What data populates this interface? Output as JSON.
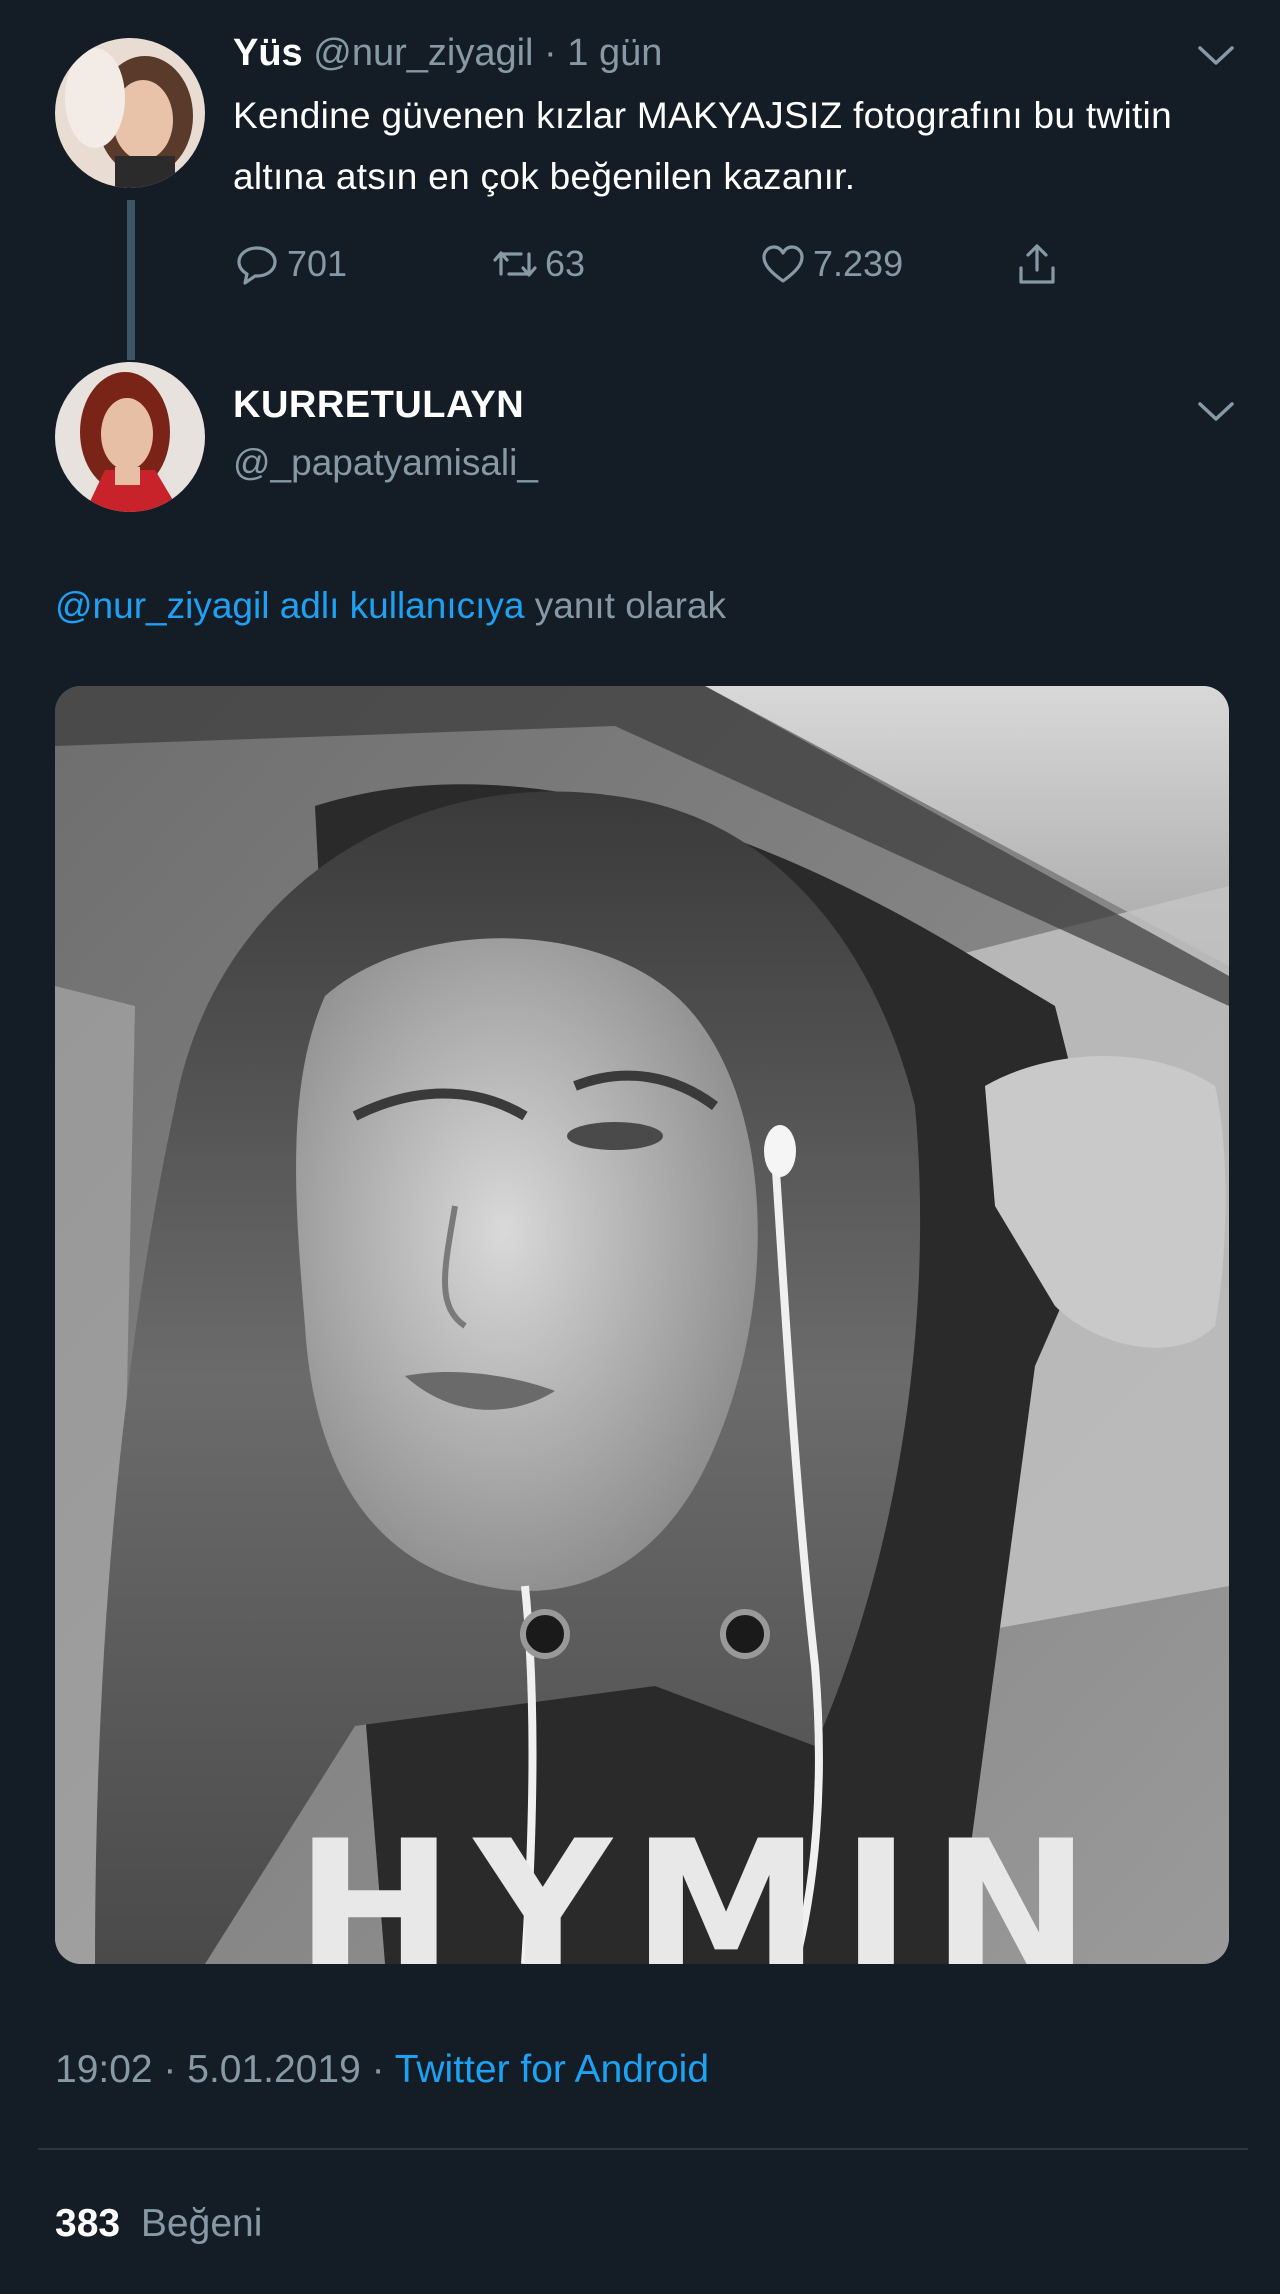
{
  "parent_tweet": {
    "display_name": "Yüs",
    "handle": "@nur_ziyagil",
    "time_ago": "1 gün",
    "text": "Kendine güvenen kızlar MAKYAJSIZ fotografını bu twitin altına atsın en çok beğenilen kazanır.",
    "reply_count": "701",
    "retweet_count": "63",
    "like_count": "7.239"
  },
  "reply_tweet": {
    "display_name": "KURRETULAYN",
    "handle": "@_papatyamisali_",
    "replying_to_link": "@nur_ziyagil adlı kullanıcıya",
    "replying_to_suffix": "yanıt olarak",
    "photo_caption": "HYMIN",
    "timestamp": "19:02 · 5.01.2019 ·",
    "source": "Twitter for Android",
    "likes_count": "383",
    "likes_label": "Beğeni"
  },
  "icons": {
    "reply": "reply-icon",
    "retweet": "retweet-icon",
    "like": "heart-icon",
    "share": "share-icon",
    "more": "chevron-down-icon"
  },
  "colors": {
    "background": "#141d26",
    "text_primary": "#ffffff",
    "text_secondary": "#8899a6",
    "link": "#1da1f2",
    "thread_line": "#3d5466"
  }
}
